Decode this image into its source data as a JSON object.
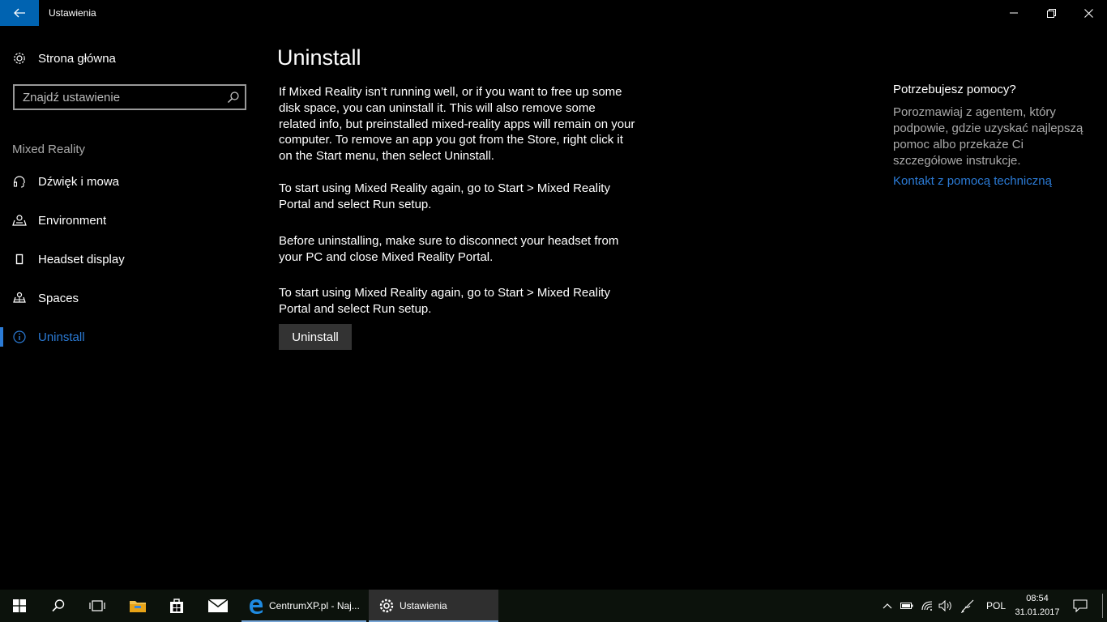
{
  "window": {
    "title": "Ustawienia"
  },
  "sidebar": {
    "home_label": "Strona główna",
    "search_placeholder": "Znajdź ustawienie",
    "section_header": "Mixed Reality",
    "items": [
      {
        "label": "Dźwięk i mowa",
        "icon": "headset-icon"
      },
      {
        "label": "Environment",
        "icon": "environment-icon"
      },
      {
        "label": "Headset display",
        "icon": "display-icon"
      },
      {
        "label": "Spaces",
        "icon": "spaces-icon"
      },
      {
        "label": "Uninstall",
        "icon": "info-icon",
        "active": true
      }
    ]
  },
  "main": {
    "title": "Uninstall",
    "paragraphs": [
      "If Mixed Reality isn’t running well, or if you want to free up some disk space, you can uninstall it. This will also remove some related info, but preinstalled mixed-reality apps will remain on your computer. To remove an app you got from the Store, right click it on the Start menu, then select Uninstall.",
      "To start using Mixed Reality again, go to Start > Mixed Reality Portal and select Run setup.",
      "Before uninstalling, make sure to disconnect your headset from your PC and close Mixed Reality Portal.",
      "To start using Mixed Reality again, go to Start > Mixed Reality Portal and select Run setup."
    ],
    "button_label": "Uninstall"
  },
  "help": {
    "title": "Potrzebujesz pomocy?",
    "text": "Porozmawiaj z agentem, który podpowie, gdzie uzyskać najlepszą pomoc albo przekaże Ci szczegółowe instrukcje.",
    "link": "Kontakt z pomocą techniczną"
  },
  "taskbar": {
    "apps": [
      {
        "label": "CentrumXP.pl - Naj..."
      },
      {
        "label": "Ustawienia"
      }
    ],
    "language": "POL",
    "time": "08:54",
    "date": "31.01.2017"
  },
  "colors": {
    "accent": "#2b7bd6",
    "back_button": "#0063b1"
  }
}
